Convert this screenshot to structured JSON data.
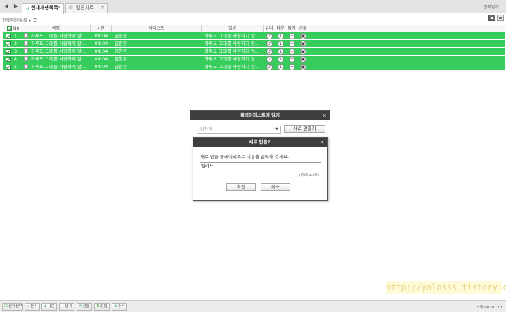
{
  "tabs": [
    {
      "icon": "♫",
      "label": "현재재생목록",
      "close": "✕"
    },
    {
      "icon": "ılı",
      "label": "멜론차트",
      "close": "✕"
    }
  ],
  "nav": {
    "back": "◀",
    "forward": "▶"
  },
  "topright_label": "전체닫기",
  "breadcrumb": "현재재생목록 ▸ 곡",
  "table": {
    "headers": {
      "no": "No",
      "song": "곡명",
      "time": "시간",
      "artist": "아티스트",
      "album": "앨범",
      "lyrics": "뮤비",
      "download": "다운",
      "add": "담기",
      "gift": "선물"
    },
    "rows": [
      {
        "no": "1",
        "song": "하루도 그대를 사랑하지 않...",
        "time": "04:04",
        "artist": "임창정",
        "album": "하루도 그대를 사랑하지 않..."
      },
      {
        "no": "2",
        "song": "하루도 그대를 사랑하지 않...",
        "time": "04:04",
        "artist": "임창정",
        "album": "하루도 그대를 사랑하지 않..."
      },
      {
        "no": "3",
        "song": "하루도 그대를 사랑하지 않...",
        "time": "04:04",
        "artist": "임창정",
        "album": "하루도 그대를 사랑하지 않..."
      },
      {
        "no": "4",
        "song": "하루도 그대를 사랑하지 않...",
        "time": "04:04",
        "artist": "임창정",
        "album": "하루도 그대를 사랑하지 않..."
      },
      {
        "no": "5",
        "song": "하루도 그대를 사랑하지 않...",
        "time": "04:04",
        "artist": "임창정",
        "album": "하루도 그대를 사랑하지 않..."
      }
    ],
    "row_icons": [
      "♪",
      "↓",
      "+",
      "−",
      "▣"
    ]
  },
  "playlist_dialog": {
    "title": "플레이리스트에 담기",
    "select_value": "임창정",
    "new_button": "새로 만들기"
  },
  "new_dialog": {
    "title": "새로 만들기",
    "prompt": "새로 만들 플레이리스트 이름을 입력해 주세요.",
    "input_value": "발라드",
    "limit": "(최대 40자)",
    "ok": "확인",
    "cancel": "취소"
  },
  "watermark": "http://yolosss.tistory.com",
  "bottom_buttons": [
    {
      "icon": "☑",
      "label": "전체선택"
    },
    {
      "icon": "▷",
      "label": "듣기"
    },
    {
      "icon": "↓",
      "label": "다운"
    },
    {
      "icon": "+",
      "label": "담기"
    },
    {
      "icon": "✉",
      "label": "선물"
    },
    {
      "icon": "⇅",
      "label": "정렬"
    },
    {
      "icon": "⊕",
      "label": "추가"
    }
  ],
  "status_text": "5곡 00:20:20",
  "colors": {
    "row_selected": "#36cd5c",
    "dialog_title": "#3e3e3e"
  }
}
